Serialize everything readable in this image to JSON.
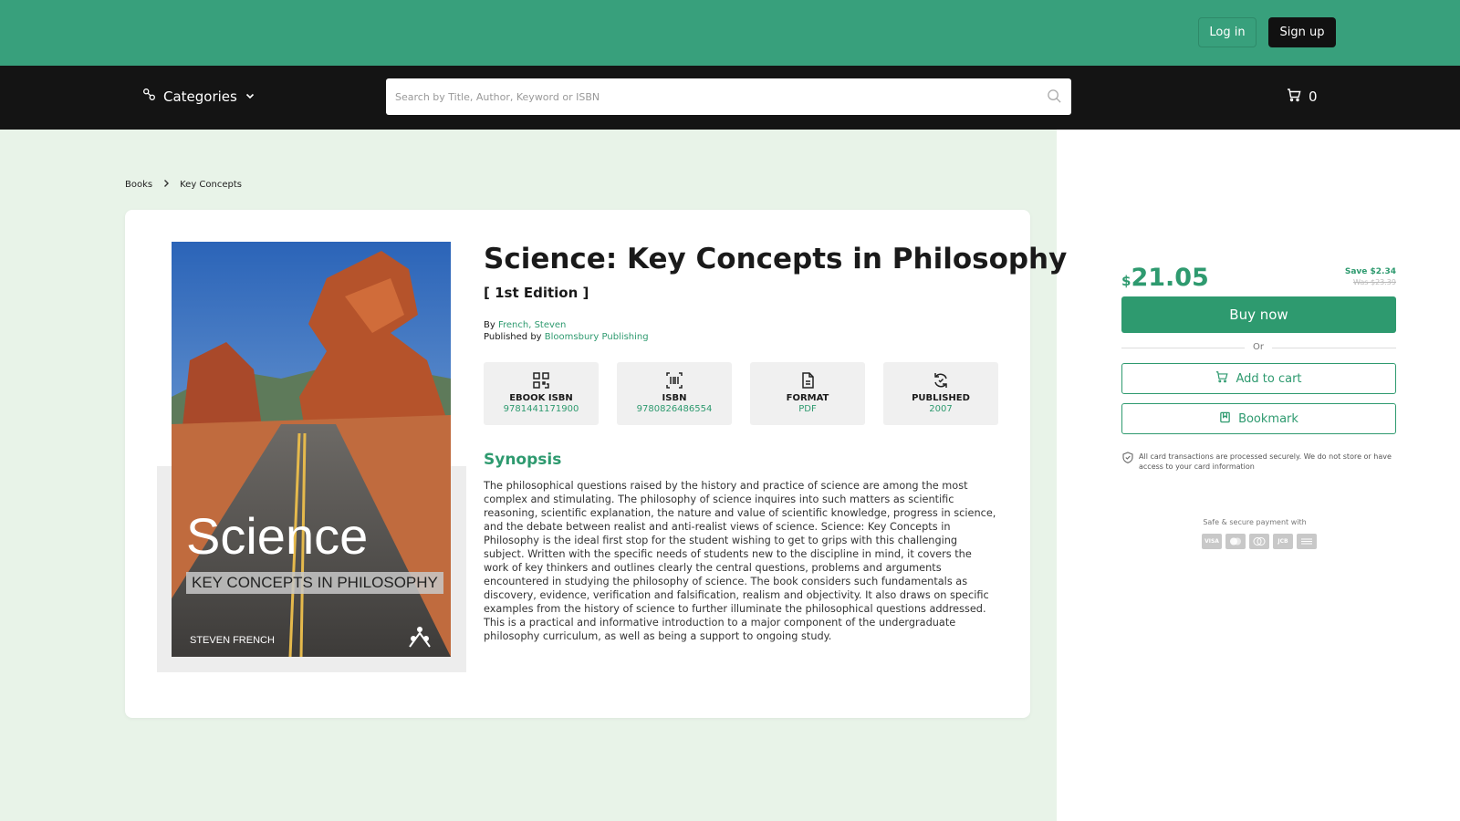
{
  "header": {
    "login_label": "Log in",
    "signup_label": "Sign up"
  },
  "nav": {
    "categories_label": "Categories",
    "search_placeholder": "Search by Title, Author, Keyword or ISBN",
    "cart_count": "0"
  },
  "breadcrumb": {
    "items": [
      "Books",
      "Key Concepts"
    ]
  },
  "book": {
    "title": "Science: Key Concepts in Philosophy",
    "edition": "[ 1st Edition ]",
    "by_prefix": "By",
    "author": "French, Steven",
    "published_prefix": "Published by",
    "publisher": "Bloomsbury Publishing",
    "cover": {
      "title": "Science",
      "subtitle": "KEY CONCEPTS IN PHILOSOPHY",
      "author": "STEVEN FRENCH"
    },
    "tiles": [
      {
        "icon": "qr-code-icon",
        "label": "EBOOK ISBN",
        "value": "9781441171900"
      },
      {
        "icon": "barcode-icon",
        "label": "ISBN",
        "value": "9780826486554"
      },
      {
        "icon": "document-icon",
        "label": "FORMAT",
        "value": "PDF"
      },
      {
        "icon": "refresh-icon",
        "label": "PUBLISHED",
        "value": "2007"
      }
    ],
    "synopsis_heading": "Synopsis",
    "synopsis": "The philosophical questions raised by the history and practice of science are among the most complex and stimulating. The philosophy of science inquires into such matters as scientific reasoning, scientific explanation, the nature and value of scientific knowledge, progress in science, and the debate between realist and anti-realist views of science. Science: Key Concepts in Philosophy is the ideal first stop for the student wishing to get to grips with this challenging subject. Written with the specific needs of students new to the discipline in mind, it covers the work of key thinkers and outlines clearly the central questions, problems and arguments encountered in studying the philosophy of science. The book considers such fundamentals as discovery, evidence, verification and falsification, realism and objectivity. It also draws on specific examples from the history of science to further illuminate the philosophical questions addressed. This is a practical and informative introduction to a major component of the undergraduate philosophy curriculum, as well as being a support to ongoing study."
  },
  "purchase": {
    "currency": "$",
    "price": "21.05",
    "save": "Save $2.34",
    "was": "Was $23.39",
    "buy_label": "Buy now",
    "or_label": "Or",
    "add_to_cart_label": "Add to cart",
    "bookmark_label": "Bookmark",
    "secure_note": "All card transactions are processed securely. We do not store or have access to your card information",
    "payment_label": "Safe & secure payment with",
    "cards": [
      "VISA",
      "MC",
      "MC",
      "JCB",
      "AMEX"
    ]
  },
  "colors": {
    "brand_green": "#38a07c",
    "accent_green": "#2e9a6f",
    "nav_dark": "#141414"
  }
}
